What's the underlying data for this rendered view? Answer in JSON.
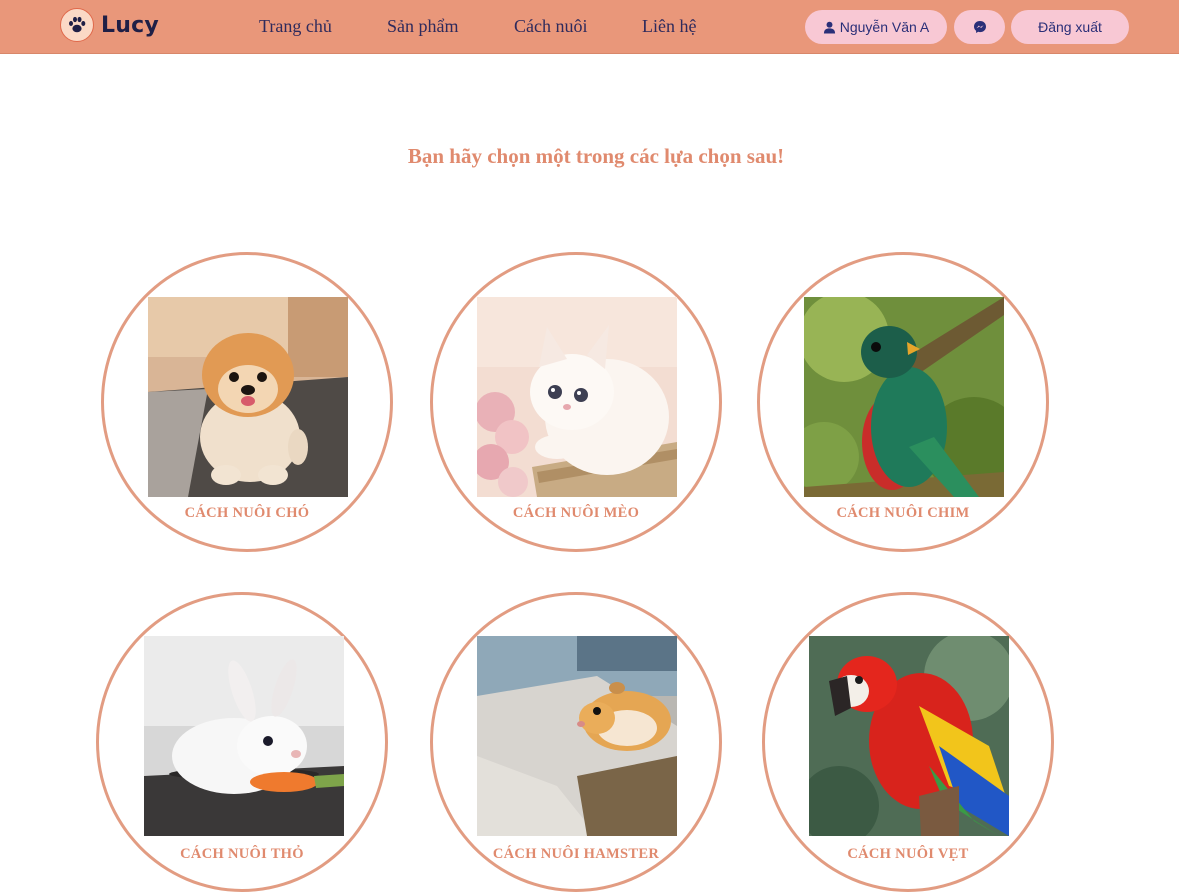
{
  "brand": {
    "name": "Lucy",
    "icon": "paw-icon"
  },
  "nav": {
    "home": "Trang chủ",
    "products": "Sản phẩm",
    "care": "Cách nuôi",
    "contact": "Liên hệ"
  },
  "user": {
    "name": "Nguyễn Văn A",
    "icon": "user-icon"
  },
  "messenger": {
    "icon": "messenger-icon"
  },
  "logout": "Đăng xuất",
  "heading": "Bạn hãy chọn một trong các lựa chọn sau!",
  "options": [
    {
      "label": "CÁCH NUÔI CHÓ",
      "image": "pomeranian-dog-photo"
    },
    {
      "label": "CÁCH NUÔI MÈO",
      "image": "white-kitten-photo"
    },
    {
      "label": "CÁCH NUÔI CHIM",
      "image": "quetzal-bird-photo"
    },
    {
      "label": "CÁCH NUÔI THỎ",
      "image": "white-rabbit-photo"
    },
    {
      "label": "CÁCH NUÔI HAMSTER",
      "image": "hamster-photo"
    },
    {
      "label": "CÁCH NUÔI VẸT",
      "image": "macaw-parrot-photo"
    }
  ],
  "colors": {
    "topbar": "#e9977a",
    "accent": "#e08a6e",
    "pill": "#f8c8d4",
    "nav_text": "#2e2a5c",
    "card_border": "#e29c82"
  }
}
